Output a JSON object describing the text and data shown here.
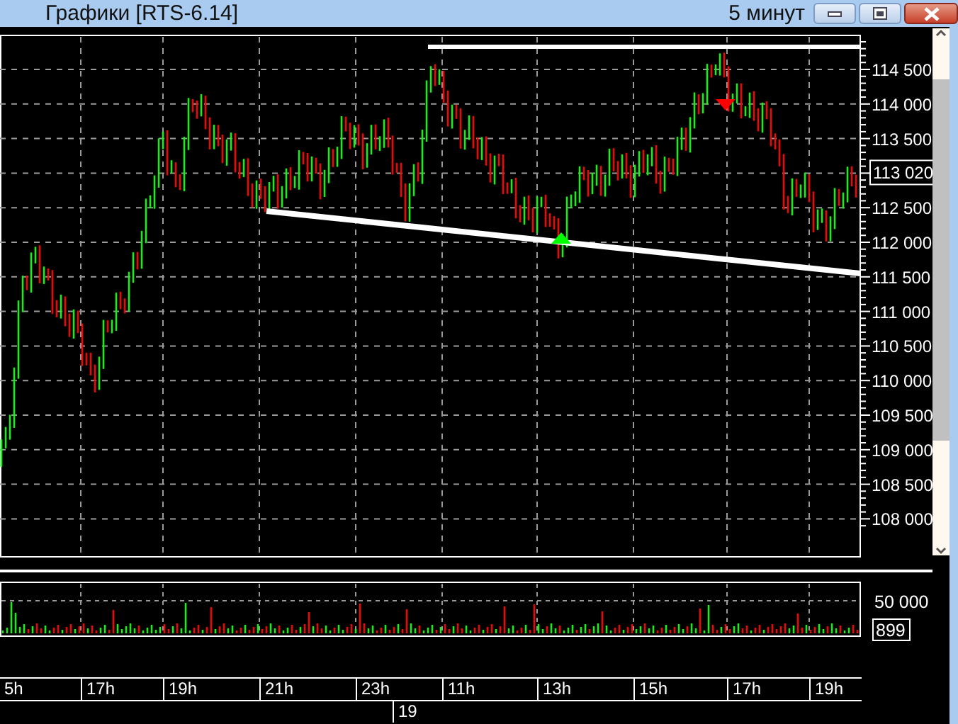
{
  "window": {
    "title": "Графики [RTS-6.14]",
    "timeframe": "5 минут"
  },
  "price_axis": {
    "labels_above": [
      "114 500",
      "114 000",
      "113 500"
    ],
    "last_price": "113 020",
    "labels_below": [
      "112 500",
      "112 000",
      "111 500",
      "111 000",
      "110 500",
      "110 000",
      "109 500",
      "109 000",
      "108 500",
      "108 000"
    ]
  },
  "volume_axis": {
    "tick": "50 000",
    "last_volume": "899"
  },
  "time_axis": {
    "labels": [
      "5h",
      "17h",
      "19h",
      "21h",
      "23h",
      "11h",
      "13h",
      "15h",
      "17h",
      "19h"
    ],
    "date": "19"
  }
}
